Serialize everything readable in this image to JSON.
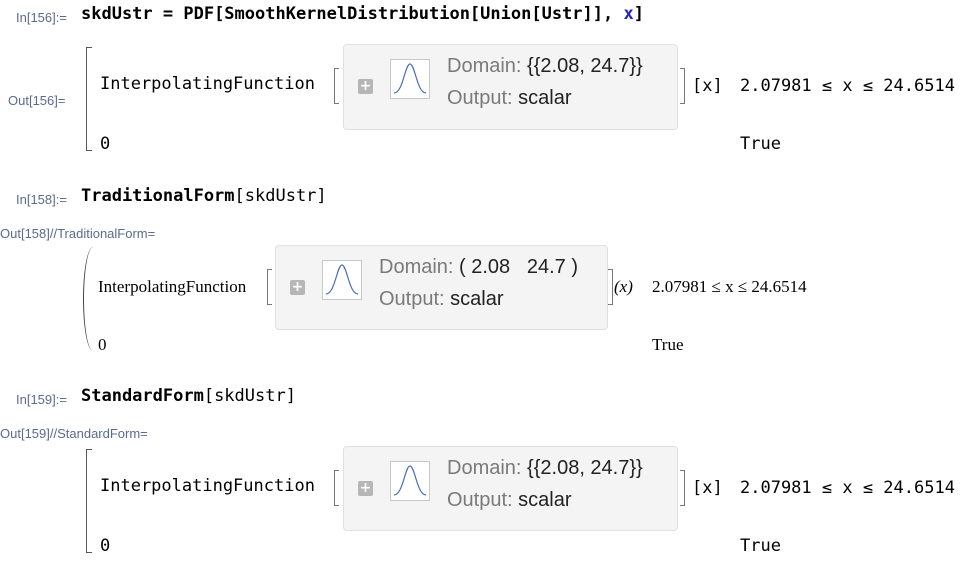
{
  "cells": [
    {
      "in_label": "In[156]:=",
      "input_var": "skdUstr",
      "input_rest_1": " = PDF[SmoothKernelDistribution[Union[Ustr]], ",
      "input_x": "x",
      "input_rest_2": "]",
      "out_label": "Out[156]=",
      "func_name": "InterpolatingFunction",
      "domain_label": "Domain: ",
      "domain_value": "{{2.08, 24.7}}",
      "output_label": "Output: ",
      "output_value": "scalar",
      "arg": "[x]",
      "condition": "2.07981 ≤ x ≤ 24.6514",
      "zero": "0",
      "true_text": "True"
    },
    {
      "in_label": "In[158]:=",
      "input_head": "TraditionalForm",
      "input_arg": "[skdUstr]",
      "out_label": "Out[158]//TraditionalForm=",
      "func_name": "InterpolatingFunction",
      "domain_label": "Domain: ",
      "domain_value": "( 2.08   24.7 )",
      "output_label": "Output: ",
      "output_value": "scalar",
      "arg": "(x)",
      "condition": "2.07981 ≤ x ≤ 24.6514",
      "zero": "0",
      "true_text": "True"
    },
    {
      "in_label": "In[159]:=",
      "input_head": "StandardForm",
      "input_arg": "[skdUstr]",
      "out_label": "Out[159]//StandardForm=",
      "func_name": "InterpolatingFunction",
      "domain_label": "Domain: ",
      "domain_value": "{{2.08, 24.7}}",
      "output_label": "Output: ",
      "output_value": "scalar",
      "arg": "[x]",
      "condition": "2.07981 ≤ x ≤ 24.6514",
      "zero": "0",
      "true_text": "True"
    }
  ],
  "colors": {
    "label": "#5a6b8c",
    "summary_bg": "#f4f4f4",
    "symbol_blue": "#2323c8"
  },
  "icons": {
    "expand": "plus-icon",
    "thumbnail": "distribution-curve-icon"
  }
}
